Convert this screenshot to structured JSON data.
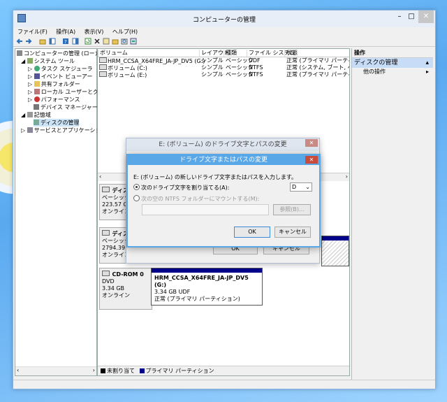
{
  "window": {
    "title": "コンピューターの管理",
    "controls": {
      "minimize": "–",
      "maximize": "□",
      "close": "✕"
    }
  },
  "menu": [
    "ファイル(F)",
    "操作(A)",
    "表示(V)",
    "ヘルプ(H)"
  ],
  "tree": {
    "root": "コンピューターの管理 (ローカル)",
    "system_tools": "システム ツール",
    "task_scheduler": "タスク スケジューラ",
    "event_viewer": "イベント ビューアー",
    "shared_folders": "共有フォルダー",
    "local_users": "ローカル ユーザーとグループ",
    "performance": "パフォーマンス",
    "device_manager": "デバイス マネージャー",
    "storage": "記憶域",
    "disk_management": "ディスクの管理",
    "services_apps": "サービスとアプリケーション"
  },
  "volume_list": {
    "headers": [
      "ボリューム",
      "レイアウト",
      "種類",
      "ファイル システム",
      "状態"
    ],
    "rows": [
      [
        "HRM_CCSA_X64FRE_JA-JP_DV5 (G:)",
        "シンプル",
        "ベーシック",
        "UDF",
        "正常 (プライマリ パーティション)"
      ],
      [
        "ボリューム (C:)",
        "シンプル",
        "ベーシック",
        "NTFS",
        "正常 (システム, ブート, ページ"
      ],
      [
        "ボリューム (E:)",
        "シンプル",
        "ベーシック",
        "NTFS",
        "正常 (プライマリ パーティション)"
      ]
    ]
  },
  "disks": [
    {
      "name": "ディスク",
      "type": "ベーシック",
      "size": "223.57 GB",
      "status": "オンライン"
    },
    {
      "name": "ディスク",
      "type": "ベーシック",
      "size": "2794.39 G",
      "status": "オンライン"
    },
    {
      "name": "CD-ROM 0",
      "type": "DVD",
      "size": "3.34 GB",
      "status": "オンライン",
      "partition": {
        "label": "HRM_CCSA_X64FRE_JA-JP_DV5  (G:)",
        "detail": "3.34 GB UDF",
        "status": "正常 (プライマリ パーティション)"
      }
    }
  ],
  "legend": {
    "unallocated": "未割り当て",
    "primary": "プライマリ パーティション",
    "unallocated_color": "#000000",
    "primary_color": "#00008b"
  },
  "actions": {
    "header": "操作",
    "section": "ディスクの管理",
    "other": "他の操作"
  },
  "dialog_back": {
    "title": "E: (ボリューム) のドライブ文字とパスの変更",
    "ok": "OK",
    "cancel": "キャンセル"
  },
  "dialog_front": {
    "title": "ドライブ文字またはパスの変更",
    "instruction": "E: (ボリューム) の新しいドライブ文字またはパスを入力します。",
    "option_letter": "次のドライブ文字を割り当てる(A):",
    "option_folder": "次の空の NTFS フォルダーにマウントする(M):",
    "letter_value": "D",
    "browse": "参照(B)...",
    "ok": "OK",
    "cancel": "キャンセル"
  }
}
